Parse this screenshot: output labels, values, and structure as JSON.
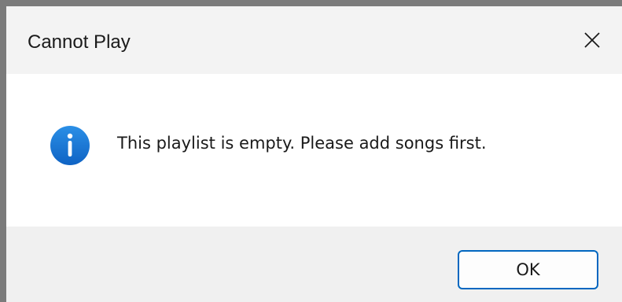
{
  "dialog": {
    "title": "Cannot Play",
    "message": "This playlist is empty. Please add songs first.",
    "icon": "info-icon",
    "ok_label": "OK",
    "close_icon": "close-icon"
  },
  "colors": {
    "accent": "#0067c0",
    "icon_blue": "#1976d2",
    "title_bar": "#f3f3f3",
    "footer": "#f0f0f0"
  }
}
